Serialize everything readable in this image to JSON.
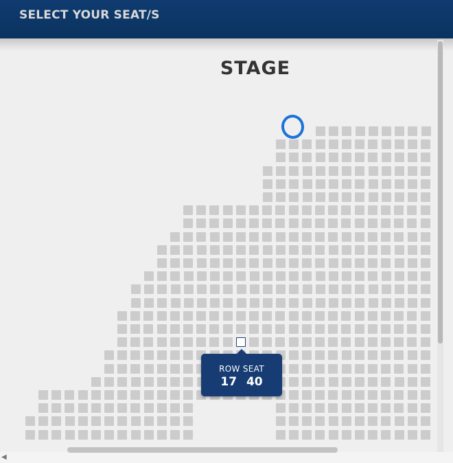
{
  "header": {
    "title": "SELECT YOUR SEAT/S"
  },
  "stage": {
    "label": "STAGE"
  },
  "tooltip": {
    "row_label": "ROW",
    "seat_label": "SEAT",
    "row_value": "17",
    "seat_value": "40"
  },
  "colors": {
    "header_bg": "#0f3b70",
    "seat_available": "#cccccc",
    "tooltip_bg": "#163c73",
    "highlight_circle": "#1a73d9",
    "background": "#efefef"
  },
  "icons": {
    "scroll_left": "triangle-left-icon"
  }
}
